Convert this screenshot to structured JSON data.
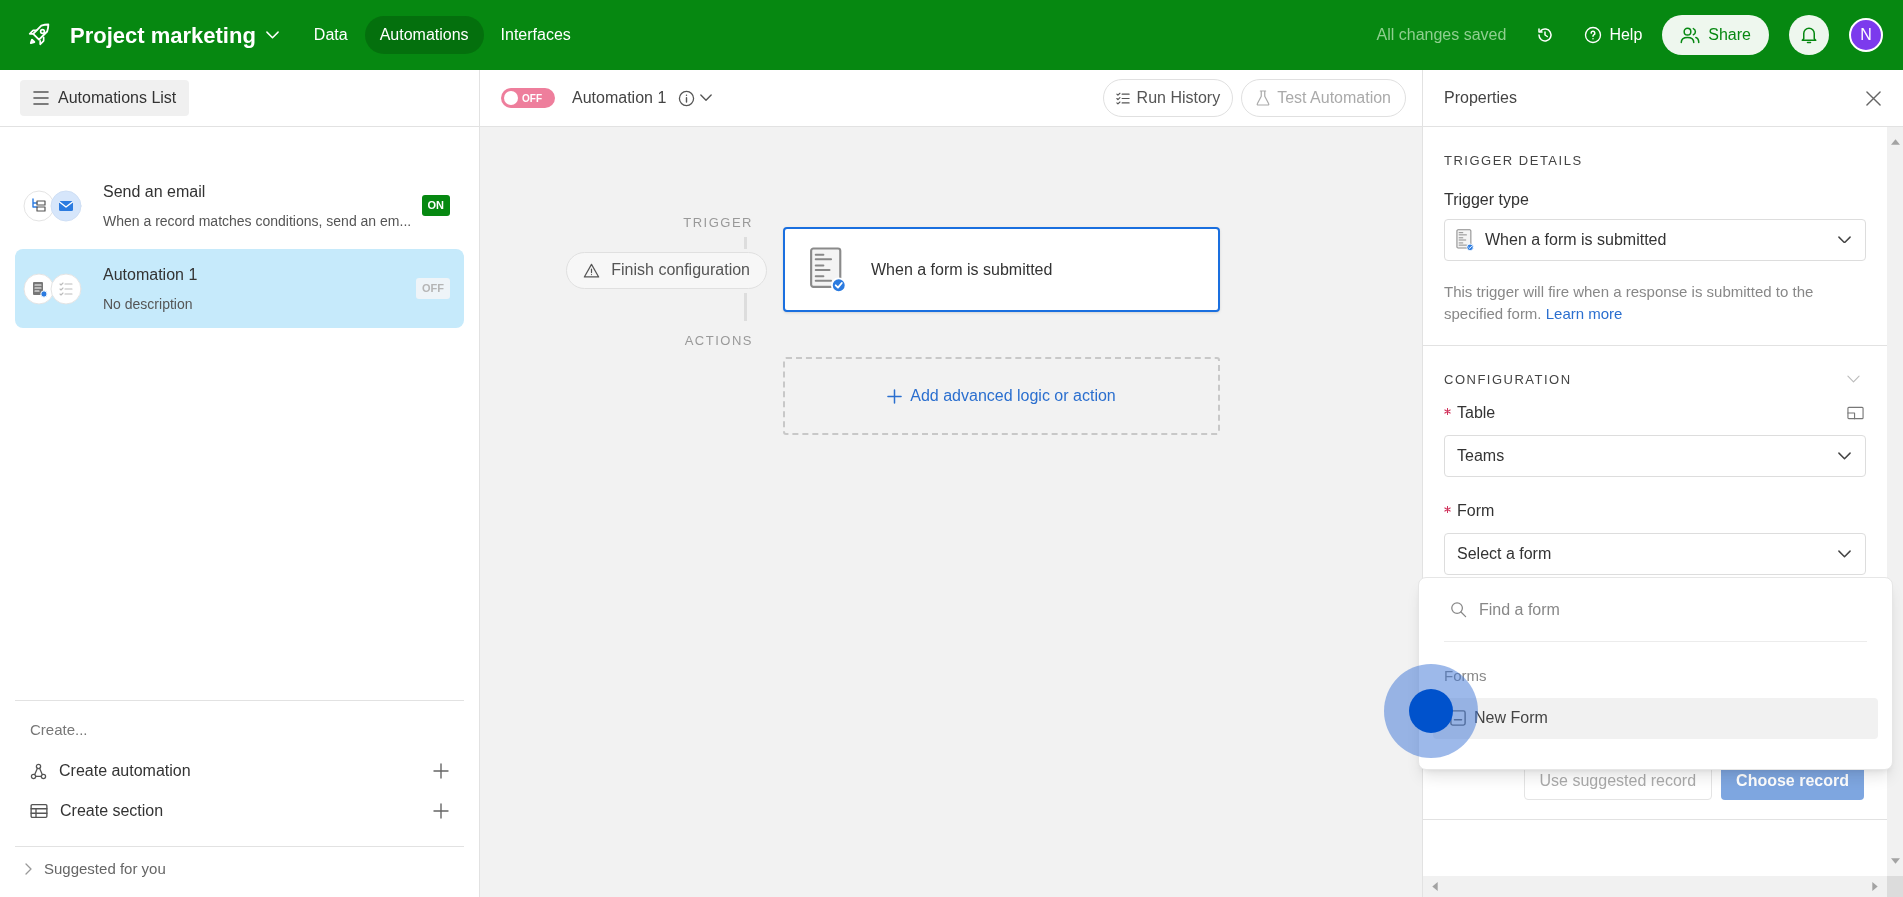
{
  "app": {
    "name": "Project marketing",
    "nav": [
      {
        "label": "Data",
        "selected": false
      },
      {
        "label": "Automations",
        "selected": true
      },
      {
        "label": "Interfaces",
        "selected": false
      }
    ],
    "save_status": "All changes saved",
    "help": "Help",
    "share": "Share",
    "avatar": "N"
  },
  "sidebar": {
    "header_button": "Automations List",
    "automations": [
      {
        "name": "Send an email",
        "description": "When a record matches conditions, send an em...",
        "kind": "email",
        "on": true,
        "status": "ON",
        "selected": false
      },
      {
        "name": "Automation 1",
        "description": "No description",
        "kind": "form",
        "on": false,
        "status": "OFF",
        "selected": true
      }
    ],
    "create_label": "Create...",
    "create_items": [
      {
        "label": "Create automation",
        "kind": "automation"
      },
      {
        "label": "Create section",
        "kind": "section"
      }
    ],
    "suggested": "Suggested for you"
  },
  "toolbar": {
    "toggle": {
      "on": false,
      "label": "OFF"
    },
    "title": "Automation 1",
    "run_history": "Run History",
    "test_automation": "Test Automation"
  },
  "canvas": {
    "trigger_label": "TRIGGER",
    "finish_config": "Finish configuration",
    "trigger_card": "When a form is submitted",
    "actions_label": "ACTIONS",
    "add_action": "Add advanced logic or action"
  },
  "properties": {
    "title": "Properties",
    "trigger_section": "TRIGGER DETAILS",
    "trigger_type_label": "Trigger type",
    "trigger_type_value": "When a form is submitted",
    "description": "This trigger will fire when a response is submitted to the specified form.",
    "learn_more": "Learn more",
    "config_section": "CONFIGURATION",
    "fields": [
      {
        "label": "Table",
        "required": true,
        "value": "Teams"
      },
      {
        "label": "Form",
        "required": true,
        "placeholder": "Select a form"
      }
    ],
    "buttons": [
      {
        "label": "Use suggested record",
        "kind": "secondary"
      },
      {
        "label": "Choose record",
        "kind": "primary"
      }
    ]
  },
  "form_dropdown": {
    "search_placeholder": "Find a form",
    "group": "Forms",
    "items": [
      {
        "label": "New Form",
        "selected": true
      }
    ]
  }
}
